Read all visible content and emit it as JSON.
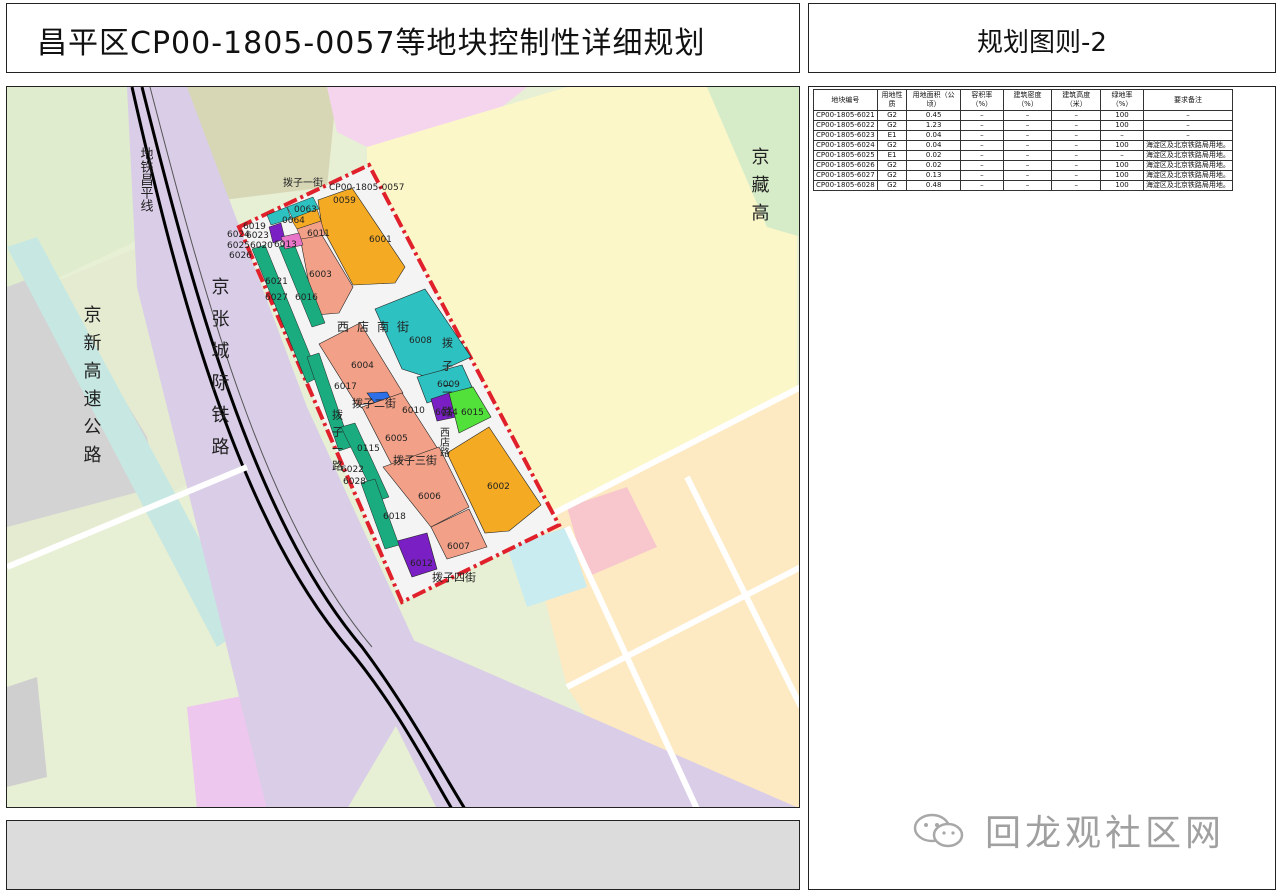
{
  "header": {
    "title": "昌平区CP00-1805-0057等地块控制性详细规划",
    "side_title": "规划图则-2"
  },
  "table": {
    "headers": [
      "地块编号",
      "用地性质",
      "用地面积（公顷）",
      "容积率（%）",
      "建筑密度（%）",
      "建筑高度（米）",
      "绿地率（%）",
      "要求备注"
    ],
    "rows": [
      [
        "CP00-1805-6021",
        "G2",
        "0.45",
        "–",
        "–",
        "–",
        "100",
        "–"
      ],
      [
        "CP00-1805-6022",
        "G2",
        "1.23",
        "–",
        "–",
        "–",
        "100",
        "–"
      ],
      [
        "CP00-1805-6023",
        "E1",
        "0.04",
        "–",
        "–",
        "–",
        "–",
        "–"
      ],
      [
        "CP00-1805-6024",
        "G2",
        "0.04",
        "–",
        "–",
        "–",
        "100",
        "海淀区及北京铁路局用地。"
      ],
      [
        "CP00-1805-6025",
        "E1",
        "0.02",
        "–",
        "–",
        "–",
        "–",
        "海淀区及北京铁路局用地。"
      ],
      [
        "CP00-1805-6026",
        "G2",
        "0.02",
        "–",
        "–",
        "–",
        "100",
        "海淀区及北京铁路局用地。"
      ],
      [
        "CP00-1805-6027",
        "G2",
        "0.13",
        "–",
        "–",
        "–",
        "100",
        "海淀区及北京铁路局用地。"
      ],
      [
        "CP00-1805-6028",
        "G2",
        "0.48",
        "–",
        "–",
        "–",
        "100",
        "海淀区及北京铁路局用地。"
      ]
    ]
  },
  "map": {
    "site_code": "CP00-1805-0057",
    "roads": {
      "metro": "地铁昌平线",
      "jingzhang": "京张城际铁路",
      "jingxin": "京新高速公路",
      "jingzang": "京藏高",
      "xidian_south": "西店南街",
      "bazi_street_1": "拨子一街",
      "bazi_street_2": "拨子二街",
      "bazi_street_3": "拨子三街",
      "bazi_road_1": "拨子一路",
      "bazi_road_2": "拨子二路",
      "bazi_road_4": "拨子四街",
      "xidian_road": "西店路"
    },
    "parcels": [
      "6001",
      "6002",
      "6003",
      "6004",
      "6005",
      "6006",
      "6007",
      "6008",
      "6009",
      "6010",
      "6011",
      "6012",
      "6013",
      "6014",
      "6015",
      "6016",
      "6017",
      "6018",
      "6019",
      "6020",
      "6021",
      "6022",
      "6023",
      "6024",
      "6025",
      "6026",
      "6027",
      "6028",
      "0059",
      "0063",
      "0064",
      "0115"
    ],
    "colors": {
      "residential": "#f4aa22",
      "commercial": "#f2a188",
      "education": "#2ec1c1",
      "green": "#1aab7f",
      "rail_band": "#d9cde8",
      "boundary": "#e0202a",
      "purple": "#7a1fc4",
      "bright_green": "#52e03a",
      "blue": "#2c6fe6"
    }
  },
  "watermark": "回龙观社区网"
}
